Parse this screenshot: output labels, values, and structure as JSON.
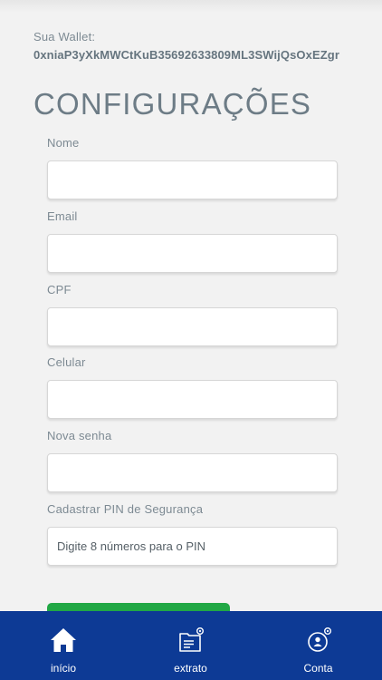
{
  "wallet": {
    "label": "Sua Wallet:",
    "address": "0xniaP3yXkMWCtKuB35692633809ML3SWijQsOxEZgr"
  },
  "page": {
    "title": "CONFIGURAÇÕES"
  },
  "form": {
    "fields": [
      {
        "label": "Nome",
        "value": "",
        "placeholder": ""
      },
      {
        "label": "Email",
        "value": "",
        "placeholder": ""
      },
      {
        "label": "CPF",
        "value": "",
        "placeholder": ""
      },
      {
        "label": "Celular",
        "value": "",
        "placeholder": ""
      },
      {
        "label": "Nova senha",
        "value": "",
        "placeholder": ""
      },
      {
        "label": "Cadastrar PIN de Segurança",
        "value": "",
        "placeholder": "Digite 8 números para o PIN"
      }
    ],
    "submit_color": "#21a845"
  },
  "nav": {
    "background": "#0d3a95",
    "items": [
      {
        "label": "início",
        "icon": "home-icon"
      },
      {
        "label": "extrato",
        "icon": "statement-folder-icon"
      },
      {
        "label": "Conta",
        "icon": "account-icon"
      }
    ]
  }
}
